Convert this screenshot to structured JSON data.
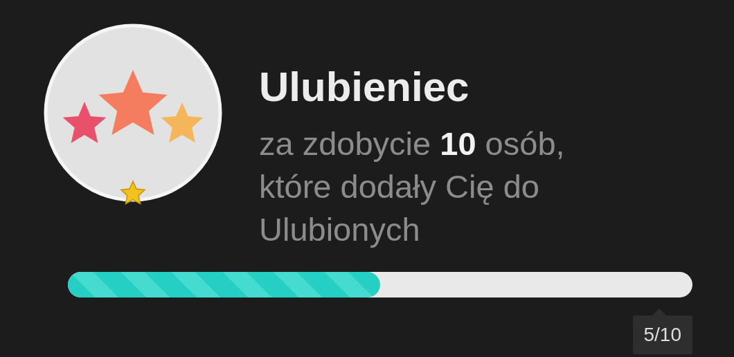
{
  "achievement": {
    "title": "Ulubieniec",
    "description": "za zdobycie **10** osób, które dodały Cię do Ulubionych",
    "progress": {
      "level": 0.5,
      "label": "5/10"
    }
  }
}
